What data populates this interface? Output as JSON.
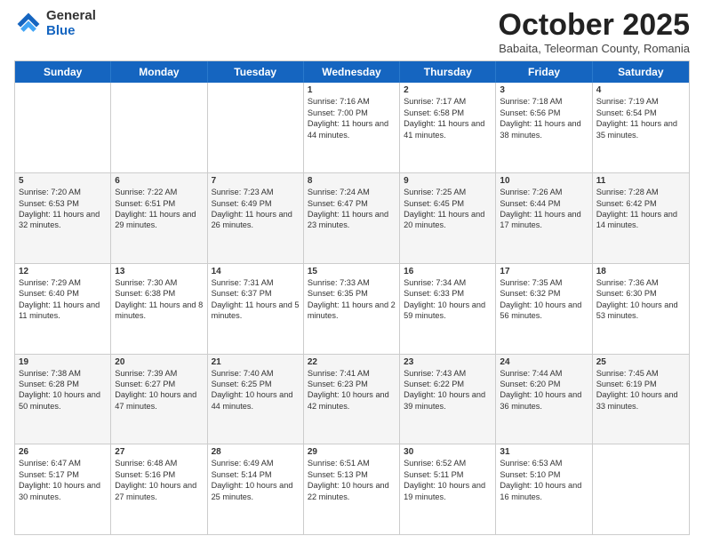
{
  "logo": {
    "general": "General",
    "blue": "Blue"
  },
  "title": "October 2025",
  "subtitle": "Babaita, Teleorman County, Romania",
  "headers": [
    "Sunday",
    "Monday",
    "Tuesday",
    "Wednesday",
    "Thursday",
    "Friday",
    "Saturday"
  ],
  "rows": [
    [
      {
        "day": "",
        "info": ""
      },
      {
        "day": "",
        "info": ""
      },
      {
        "day": "",
        "info": ""
      },
      {
        "day": "1",
        "info": "Sunrise: 7:16 AM\nSunset: 7:00 PM\nDaylight: 11 hours and 44 minutes."
      },
      {
        "day": "2",
        "info": "Sunrise: 7:17 AM\nSunset: 6:58 PM\nDaylight: 11 hours and 41 minutes."
      },
      {
        "day": "3",
        "info": "Sunrise: 7:18 AM\nSunset: 6:56 PM\nDaylight: 11 hours and 38 minutes."
      },
      {
        "day": "4",
        "info": "Sunrise: 7:19 AM\nSunset: 6:54 PM\nDaylight: 11 hours and 35 minutes."
      }
    ],
    [
      {
        "day": "5",
        "info": "Sunrise: 7:20 AM\nSunset: 6:53 PM\nDaylight: 11 hours and 32 minutes."
      },
      {
        "day": "6",
        "info": "Sunrise: 7:22 AM\nSunset: 6:51 PM\nDaylight: 11 hours and 29 minutes."
      },
      {
        "day": "7",
        "info": "Sunrise: 7:23 AM\nSunset: 6:49 PM\nDaylight: 11 hours and 26 minutes."
      },
      {
        "day": "8",
        "info": "Sunrise: 7:24 AM\nSunset: 6:47 PM\nDaylight: 11 hours and 23 minutes."
      },
      {
        "day": "9",
        "info": "Sunrise: 7:25 AM\nSunset: 6:45 PM\nDaylight: 11 hours and 20 minutes."
      },
      {
        "day": "10",
        "info": "Sunrise: 7:26 AM\nSunset: 6:44 PM\nDaylight: 11 hours and 17 minutes."
      },
      {
        "day": "11",
        "info": "Sunrise: 7:28 AM\nSunset: 6:42 PM\nDaylight: 11 hours and 14 minutes."
      }
    ],
    [
      {
        "day": "12",
        "info": "Sunrise: 7:29 AM\nSunset: 6:40 PM\nDaylight: 11 hours and 11 minutes."
      },
      {
        "day": "13",
        "info": "Sunrise: 7:30 AM\nSunset: 6:38 PM\nDaylight: 11 hours and 8 minutes."
      },
      {
        "day": "14",
        "info": "Sunrise: 7:31 AM\nSunset: 6:37 PM\nDaylight: 11 hours and 5 minutes."
      },
      {
        "day": "15",
        "info": "Sunrise: 7:33 AM\nSunset: 6:35 PM\nDaylight: 11 hours and 2 minutes."
      },
      {
        "day": "16",
        "info": "Sunrise: 7:34 AM\nSunset: 6:33 PM\nDaylight: 10 hours and 59 minutes."
      },
      {
        "day": "17",
        "info": "Sunrise: 7:35 AM\nSunset: 6:32 PM\nDaylight: 10 hours and 56 minutes."
      },
      {
        "day": "18",
        "info": "Sunrise: 7:36 AM\nSunset: 6:30 PM\nDaylight: 10 hours and 53 minutes."
      }
    ],
    [
      {
        "day": "19",
        "info": "Sunrise: 7:38 AM\nSunset: 6:28 PM\nDaylight: 10 hours and 50 minutes."
      },
      {
        "day": "20",
        "info": "Sunrise: 7:39 AM\nSunset: 6:27 PM\nDaylight: 10 hours and 47 minutes."
      },
      {
        "day": "21",
        "info": "Sunrise: 7:40 AM\nSunset: 6:25 PM\nDaylight: 10 hours and 44 minutes."
      },
      {
        "day": "22",
        "info": "Sunrise: 7:41 AM\nSunset: 6:23 PM\nDaylight: 10 hours and 42 minutes."
      },
      {
        "day": "23",
        "info": "Sunrise: 7:43 AM\nSunset: 6:22 PM\nDaylight: 10 hours and 39 minutes."
      },
      {
        "day": "24",
        "info": "Sunrise: 7:44 AM\nSunset: 6:20 PM\nDaylight: 10 hours and 36 minutes."
      },
      {
        "day": "25",
        "info": "Sunrise: 7:45 AM\nSunset: 6:19 PM\nDaylight: 10 hours and 33 minutes."
      }
    ],
    [
      {
        "day": "26",
        "info": "Sunrise: 6:47 AM\nSunset: 5:17 PM\nDaylight: 10 hours and 30 minutes."
      },
      {
        "day": "27",
        "info": "Sunrise: 6:48 AM\nSunset: 5:16 PM\nDaylight: 10 hours and 27 minutes."
      },
      {
        "day": "28",
        "info": "Sunrise: 6:49 AM\nSunset: 5:14 PM\nDaylight: 10 hours and 25 minutes."
      },
      {
        "day": "29",
        "info": "Sunrise: 6:51 AM\nSunset: 5:13 PM\nDaylight: 10 hours and 22 minutes."
      },
      {
        "day": "30",
        "info": "Sunrise: 6:52 AM\nSunset: 5:11 PM\nDaylight: 10 hours and 19 minutes."
      },
      {
        "day": "31",
        "info": "Sunrise: 6:53 AM\nSunset: 5:10 PM\nDaylight: 10 hours and 16 minutes."
      },
      {
        "day": "",
        "info": ""
      }
    ]
  ]
}
